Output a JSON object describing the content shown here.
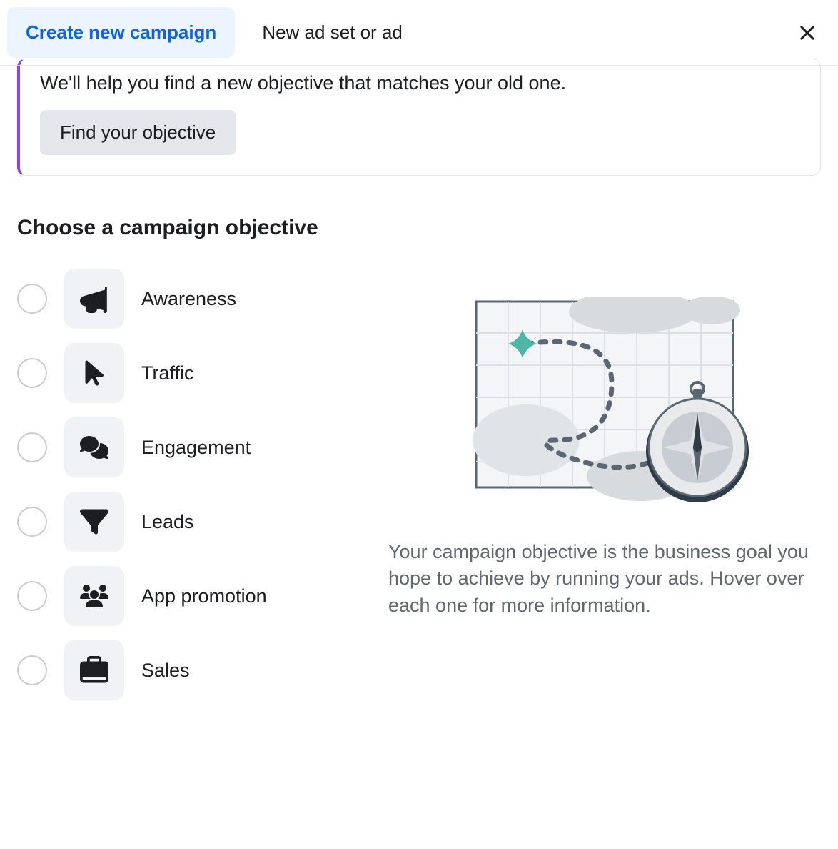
{
  "tabs": {
    "active": "Create new campaign",
    "inactive": "New ad set or ad"
  },
  "banner": {
    "text": "We'll help you find a new objective that matches your old one.",
    "button": "Find your objective"
  },
  "section_title": "Choose a campaign objective",
  "objectives": [
    {
      "label": "Awareness",
      "icon": "megaphone"
    },
    {
      "label": "Traffic",
      "icon": "cursor"
    },
    {
      "label": "Engagement",
      "icon": "comments"
    },
    {
      "label": "Leads",
      "icon": "funnel"
    },
    {
      "label": "App promotion",
      "icon": "users"
    },
    {
      "label": "Sales",
      "icon": "briefcase"
    }
  ],
  "info_text": "Your campaign objective is the business goal you hope to achieve by running your ads. Hover over each one for more information."
}
